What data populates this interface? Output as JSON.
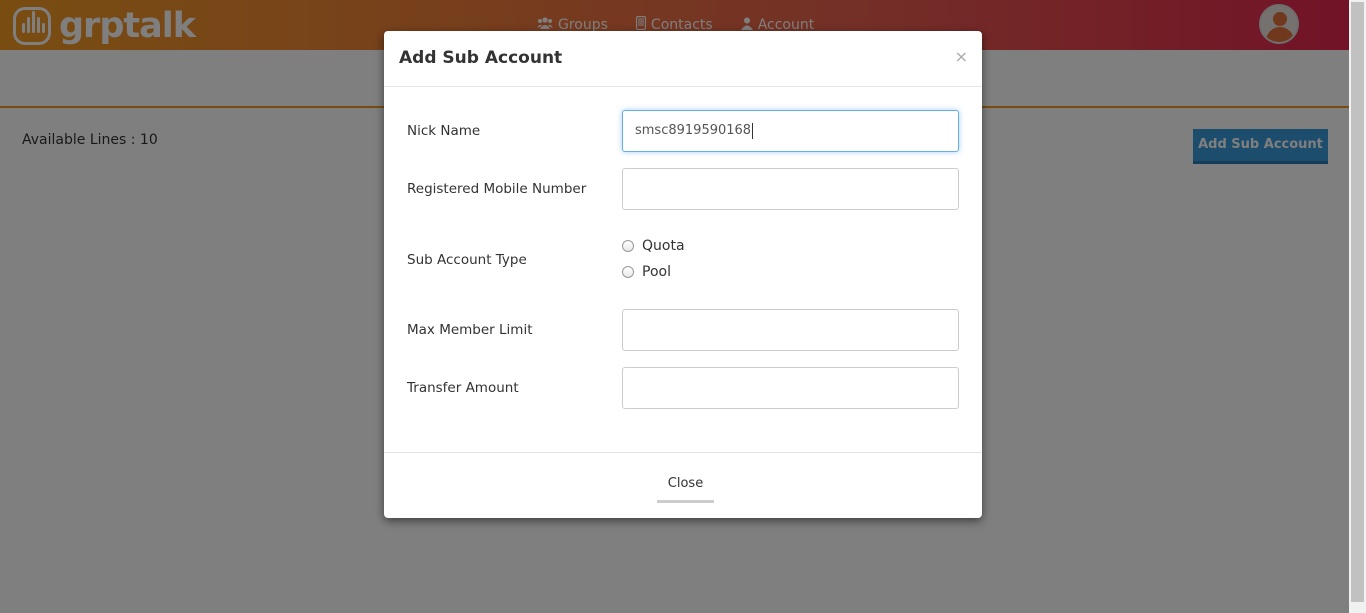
{
  "brand": {
    "name": "grptalk"
  },
  "nav": {
    "items": [
      {
        "label": "Groups",
        "icon": "users-icon"
      },
      {
        "label": "Contacts",
        "icon": "phone-icon"
      },
      {
        "label": "Account",
        "icon": "user-icon"
      }
    ]
  },
  "page": {
    "available_lines": "Available Lines : 10",
    "add_button_label": "Add Sub Account"
  },
  "modal": {
    "title": "Add Sub Account",
    "close_x": "×",
    "fields": {
      "nick_name": {
        "label": "Nick Name",
        "value": "smsc8919590168"
      },
      "mobile": {
        "label": "Registered Mobile Number",
        "value": ""
      },
      "sub_account_type": {
        "label": "Sub Account Type",
        "options": [
          "Quota",
          "Pool"
        ]
      },
      "max_member": {
        "label": "Max Member Limit",
        "value": ""
      },
      "transfer_amount": {
        "label": "Transfer Amount",
        "value": ""
      }
    },
    "close_label": "Close"
  },
  "colors": {
    "header_gradient_start": "#f29b24",
    "header_gradient_end": "#e4264f",
    "primary_button": "#3a9ad9",
    "focus_border": "#66afe9"
  }
}
